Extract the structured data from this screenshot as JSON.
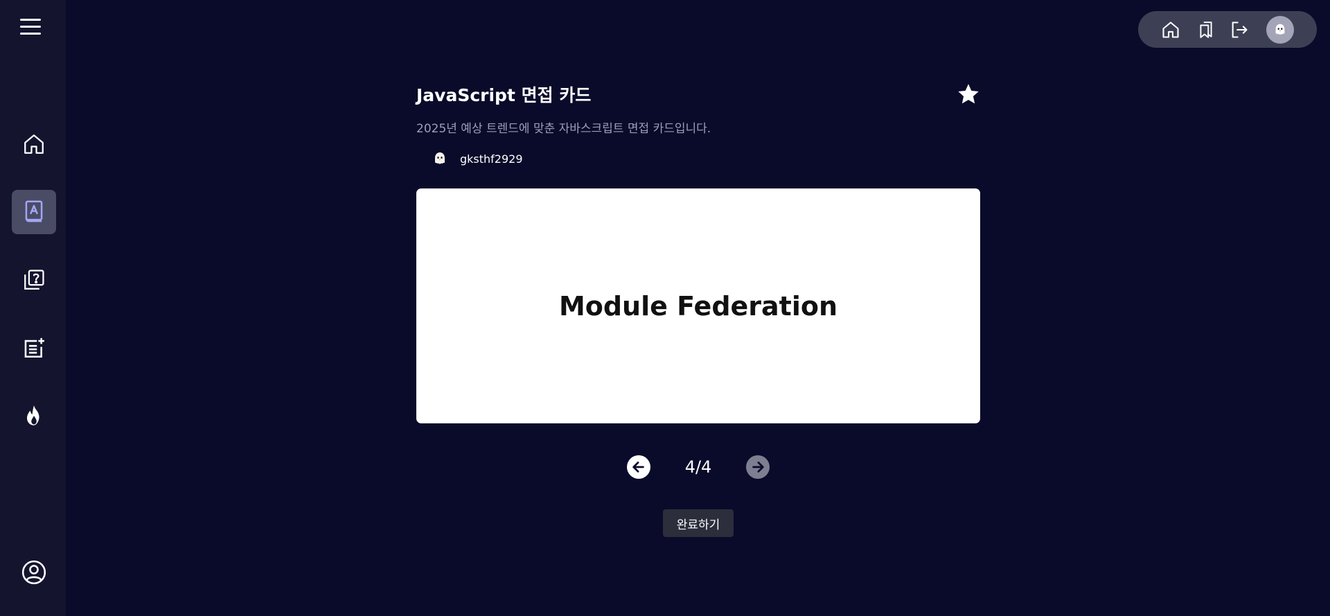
{
  "sidebar": {
    "icons": [
      "menu-icon",
      "home-icon",
      "flashcard-book-icon",
      "quiz-icon",
      "add-note-icon",
      "fire-icon",
      "profile-icon"
    ],
    "active_item": "flashcard-book-icon"
  },
  "topbar": {
    "icons": [
      "home-icon",
      "bookmark-icon",
      "logout-icon",
      "ghost-avatar-icon"
    ]
  },
  "deck": {
    "title": "JavaScript 면접 카드",
    "description": "2025년 예상 트렌드에 맞춘 자바스크립트 면접 카드입니다.",
    "author": "gksthf2929",
    "favorited": true
  },
  "card": {
    "term": "Module Federation"
  },
  "pager": {
    "position": "4/4"
  },
  "actions": {
    "complete_label": "완료하기"
  },
  "colors": {
    "background": "#0a0a2a",
    "sidebar": "#14142e",
    "active_nav": "#4a4c66",
    "accent_icon": "#a4a6f2",
    "topbar": "#3d3f54"
  }
}
